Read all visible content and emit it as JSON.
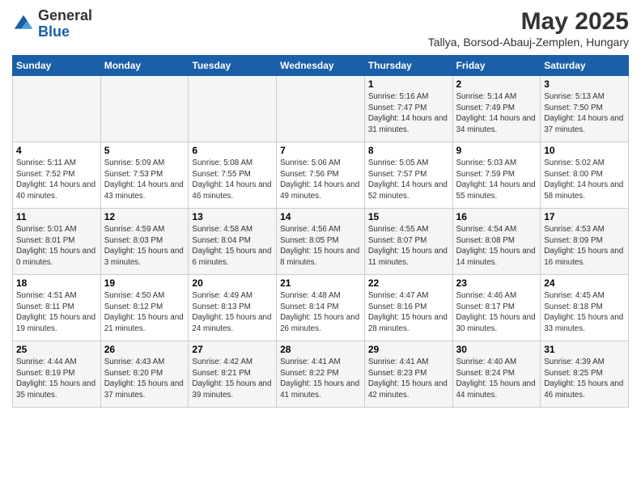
{
  "logo": {
    "general": "General",
    "blue": "Blue"
  },
  "header": {
    "title": "May 2025",
    "subtitle": "Tallya, Borsod-Abauj-Zemplen, Hungary"
  },
  "columns": [
    "Sunday",
    "Monday",
    "Tuesday",
    "Wednesday",
    "Thursday",
    "Friday",
    "Saturday"
  ],
  "weeks": [
    [
      {
        "day": "",
        "info": ""
      },
      {
        "day": "",
        "info": ""
      },
      {
        "day": "",
        "info": ""
      },
      {
        "day": "",
        "info": ""
      },
      {
        "day": "1",
        "info": "Sunrise: 5:16 AM\nSunset: 7:47 PM\nDaylight: 14 hours and 31 minutes."
      },
      {
        "day": "2",
        "info": "Sunrise: 5:14 AM\nSunset: 7:49 PM\nDaylight: 14 hours and 34 minutes."
      },
      {
        "day": "3",
        "info": "Sunrise: 5:13 AM\nSunset: 7:50 PM\nDaylight: 14 hours and 37 minutes."
      }
    ],
    [
      {
        "day": "4",
        "info": "Sunrise: 5:11 AM\nSunset: 7:52 PM\nDaylight: 14 hours and 40 minutes."
      },
      {
        "day": "5",
        "info": "Sunrise: 5:09 AM\nSunset: 7:53 PM\nDaylight: 14 hours and 43 minutes."
      },
      {
        "day": "6",
        "info": "Sunrise: 5:08 AM\nSunset: 7:55 PM\nDaylight: 14 hours and 46 minutes."
      },
      {
        "day": "7",
        "info": "Sunrise: 5:06 AM\nSunset: 7:56 PM\nDaylight: 14 hours and 49 minutes."
      },
      {
        "day": "8",
        "info": "Sunrise: 5:05 AM\nSunset: 7:57 PM\nDaylight: 14 hours and 52 minutes."
      },
      {
        "day": "9",
        "info": "Sunrise: 5:03 AM\nSunset: 7:59 PM\nDaylight: 14 hours and 55 minutes."
      },
      {
        "day": "10",
        "info": "Sunrise: 5:02 AM\nSunset: 8:00 PM\nDaylight: 14 hours and 58 minutes."
      }
    ],
    [
      {
        "day": "11",
        "info": "Sunrise: 5:01 AM\nSunset: 8:01 PM\nDaylight: 15 hours and 0 minutes."
      },
      {
        "day": "12",
        "info": "Sunrise: 4:59 AM\nSunset: 8:03 PM\nDaylight: 15 hours and 3 minutes."
      },
      {
        "day": "13",
        "info": "Sunrise: 4:58 AM\nSunset: 8:04 PM\nDaylight: 15 hours and 6 minutes."
      },
      {
        "day": "14",
        "info": "Sunrise: 4:56 AM\nSunset: 8:05 PM\nDaylight: 15 hours and 8 minutes."
      },
      {
        "day": "15",
        "info": "Sunrise: 4:55 AM\nSunset: 8:07 PM\nDaylight: 15 hours and 11 minutes."
      },
      {
        "day": "16",
        "info": "Sunrise: 4:54 AM\nSunset: 8:08 PM\nDaylight: 15 hours and 14 minutes."
      },
      {
        "day": "17",
        "info": "Sunrise: 4:53 AM\nSunset: 8:09 PM\nDaylight: 15 hours and 16 minutes."
      }
    ],
    [
      {
        "day": "18",
        "info": "Sunrise: 4:51 AM\nSunset: 8:11 PM\nDaylight: 15 hours and 19 minutes."
      },
      {
        "day": "19",
        "info": "Sunrise: 4:50 AM\nSunset: 8:12 PM\nDaylight: 15 hours and 21 minutes."
      },
      {
        "day": "20",
        "info": "Sunrise: 4:49 AM\nSunset: 8:13 PM\nDaylight: 15 hours and 24 minutes."
      },
      {
        "day": "21",
        "info": "Sunrise: 4:48 AM\nSunset: 8:14 PM\nDaylight: 15 hours and 26 minutes."
      },
      {
        "day": "22",
        "info": "Sunrise: 4:47 AM\nSunset: 8:16 PM\nDaylight: 15 hours and 28 minutes."
      },
      {
        "day": "23",
        "info": "Sunrise: 4:46 AM\nSunset: 8:17 PM\nDaylight: 15 hours and 30 minutes."
      },
      {
        "day": "24",
        "info": "Sunrise: 4:45 AM\nSunset: 8:18 PM\nDaylight: 15 hours and 33 minutes."
      }
    ],
    [
      {
        "day": "25",
        "info": "Sunrise: 4:44 AM\nSunset: 8:19 PM\nDaylight: 15 hours and 35 minutes."
      },
      {
        "day": "26",
        "info": "Sunrise: 4:43 AM\nSunset: 8:20 PM\nDaylight: 15 hours and 37 minutes."
      },
      {
        "day": "27",
        "info": "Sunrise: 4:42 AM\nSunset: 8:21 PM\nDaylight: 15 hours and 39 minutes."
      },
      {
        "day": "28",
        "info": "Sunrise: 4:41 AM\nSunset: 8:22 PM\nDaylight: 15 hours and 41 minutes."
      },
      {
        "day": "29",
        "info": "Sunrise: 4:41 AM\nSunset: 8:23 PM\nDaylight: 15 hours and 42 minutes."
      },
      {
        "day": "30",
        "info": "Sunrise: 4:40 AM\nSunset: 8:24 PM\nDaylight: 15 hours and 44 minutes."
      },
      {
        "day": "31",
        "info": "Sunrise: 4:39 AM\nSunset: 8:25 PM\nDaylight: 15 hours and 46 minutes."
      }
    ]
  ]
}
